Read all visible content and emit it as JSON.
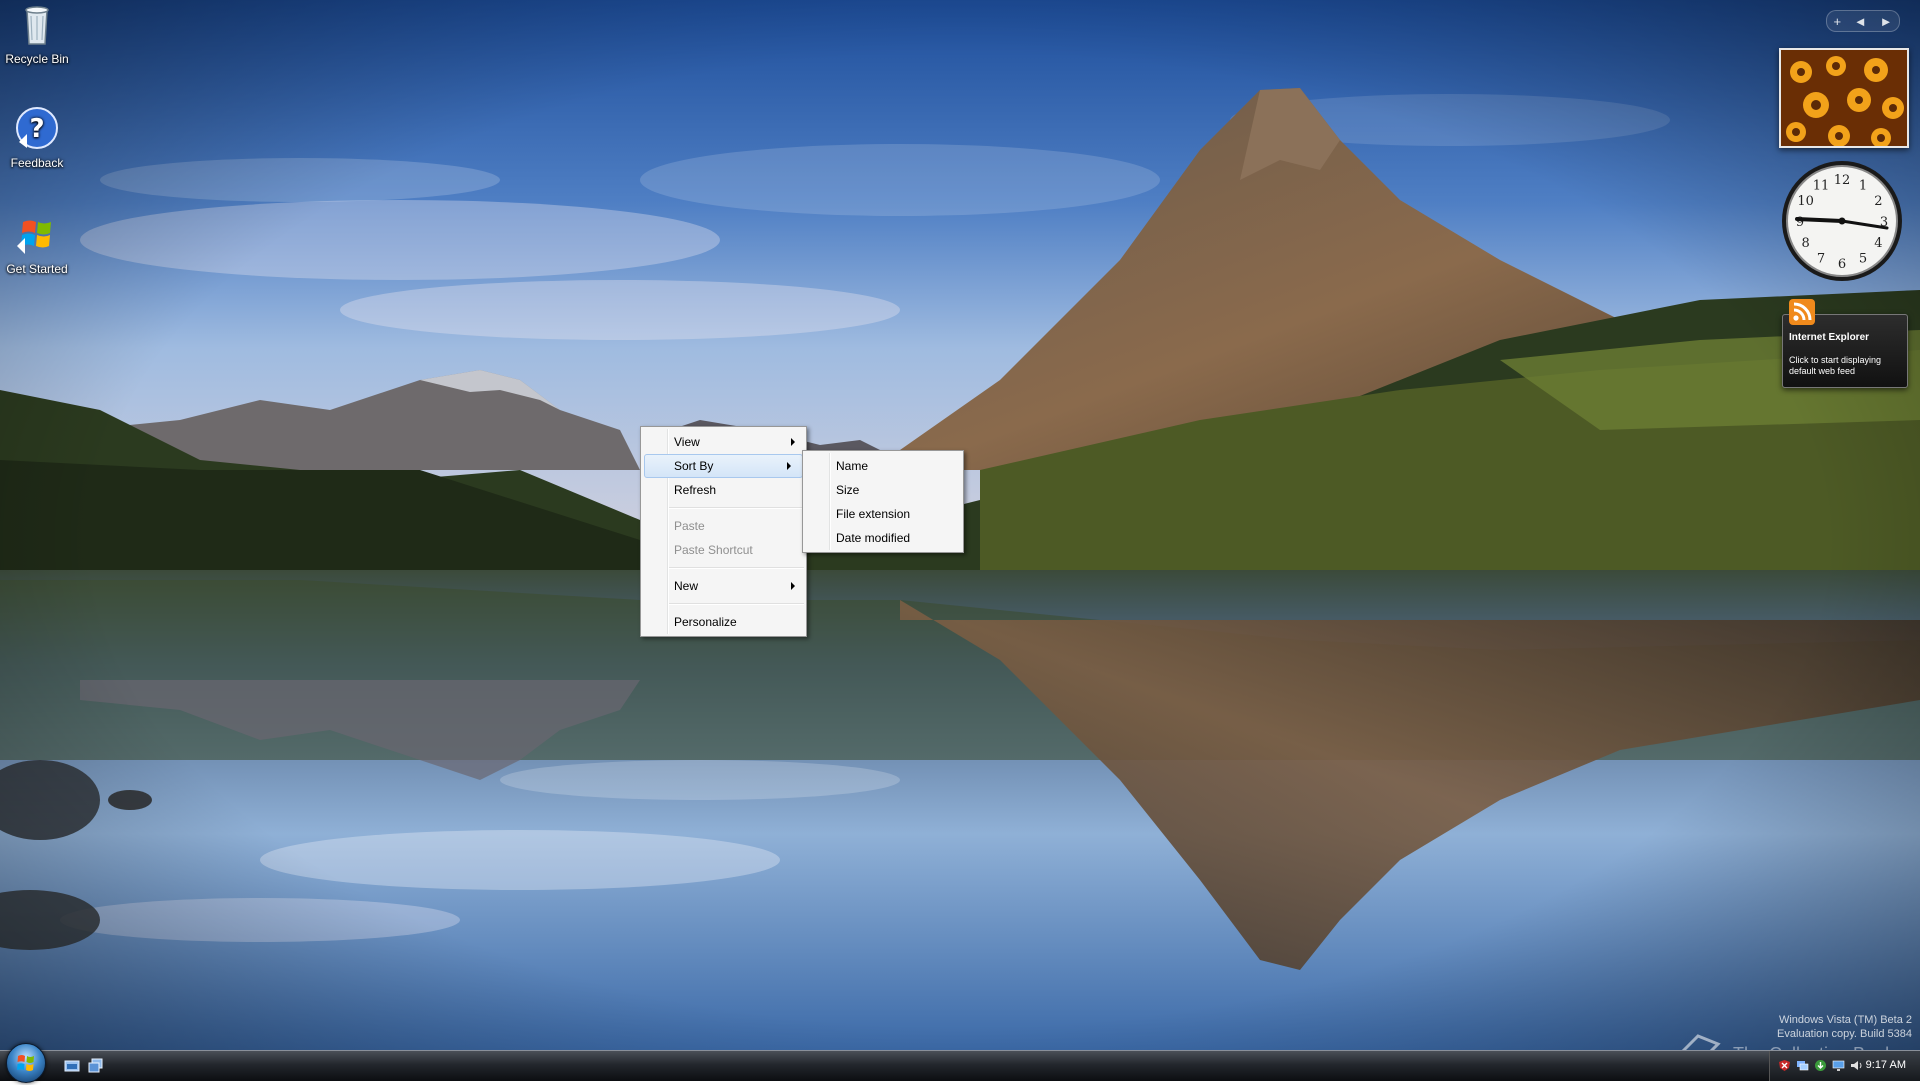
{
  "desktop": {
    "icons": [
      {
        "label": "Recycle Bin",
        "icon": "recycle-bin-icon"
      },
      {
        "label": "Feedback",
        "icon": "feedback-icon"
      },
      {
        "label": "Get Started",
        "icon": "windows-logo-icon"
      }
    ]
  },
  "sidebar": {
    "controls": {
      "add": "+",
      "prev": "◄",
      "next": "►"
    },
    "feed_gadget": {
      "title": "Internet Explorer",
      "message": "Click to start displaying default web feed"
    },
    "clock_numbers": [
      "12",
      "1",
      "2",
      "3",
      "4",
      "5",
      "6",
      "7",
      "8",
      "9",
      "10",
      "11"
    ]
  },
  "context_menu": {
    "items": [
      {
        "label": "View",
        "submenu": true,
        "enabled": true
      },
      {
        "label": "Sort By",
        "submenu": true,
        "enabled": true,
        "highlighted": true
      },
      {
        "label": "Refresh",
        "enabled": true
      },
      {
        "label": "Paste",
        "enabled": false
      },
      {
        "label": "Paste Shortcut",
        "enabled": false
      },
      {
        "label": "New",
        "submenu": true,
        "enabled": true
      },
      {
        "label": "Personalize",
        "enabled": true
      }
    ]
  },
  "sort_by_submenu": {
    "items": [
      "Name",
      "Size",
      "File extension",
      "Date modified"
    ]
  },
  "watermark": {
    "line1": "Windows Vista (TM) Beta 2",
    "line2": "Evaluation copy. Build 5384"
  },
  "collection_logo": "The Collection Book",
  "taskbar": {
    "clock": "9:17 AM"
  },
  "colors": {
    "menu_bg": "#f5f5f5",
    "menu_highlight": "#d4e5f8",
    "taskbar": "#1c1f24"
  }
}
